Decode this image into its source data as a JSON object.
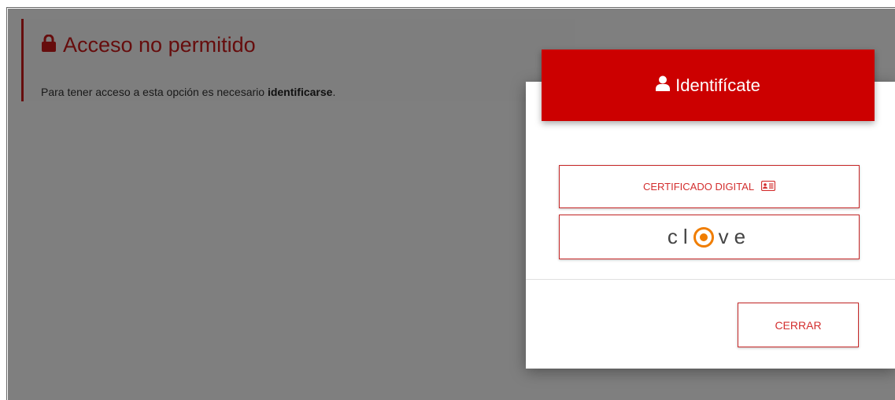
{
  "alert": {
    "icon": "lock-icon",
    "title": "Acceso no permitido",
    "text_prefix": "Para tener acceso a esta opción es necesario ",
    "text_bold": "identificarse",
    "text_suffix": "."
  },
  "modal": {
    "header": {
      "icon": "user-icon",
      "title": "Identifícate"
    },
    "certificate_button": {
      "label": "CERTIFICADO DIGITAL",
      "icon": "id-card-icon"
    },
    "clave_button": {
      "logo_text_before": "cl",
      "logo_text_after": "ve"
    },
    "close_button": {
      "label": "CERRAR"
    }
  },
  "colors": {
    "accent": "#cc0000",
    "clave_orange": "#f07d00",
    "overlay": "rgba(0,0,0,0.5)"
  }
}
